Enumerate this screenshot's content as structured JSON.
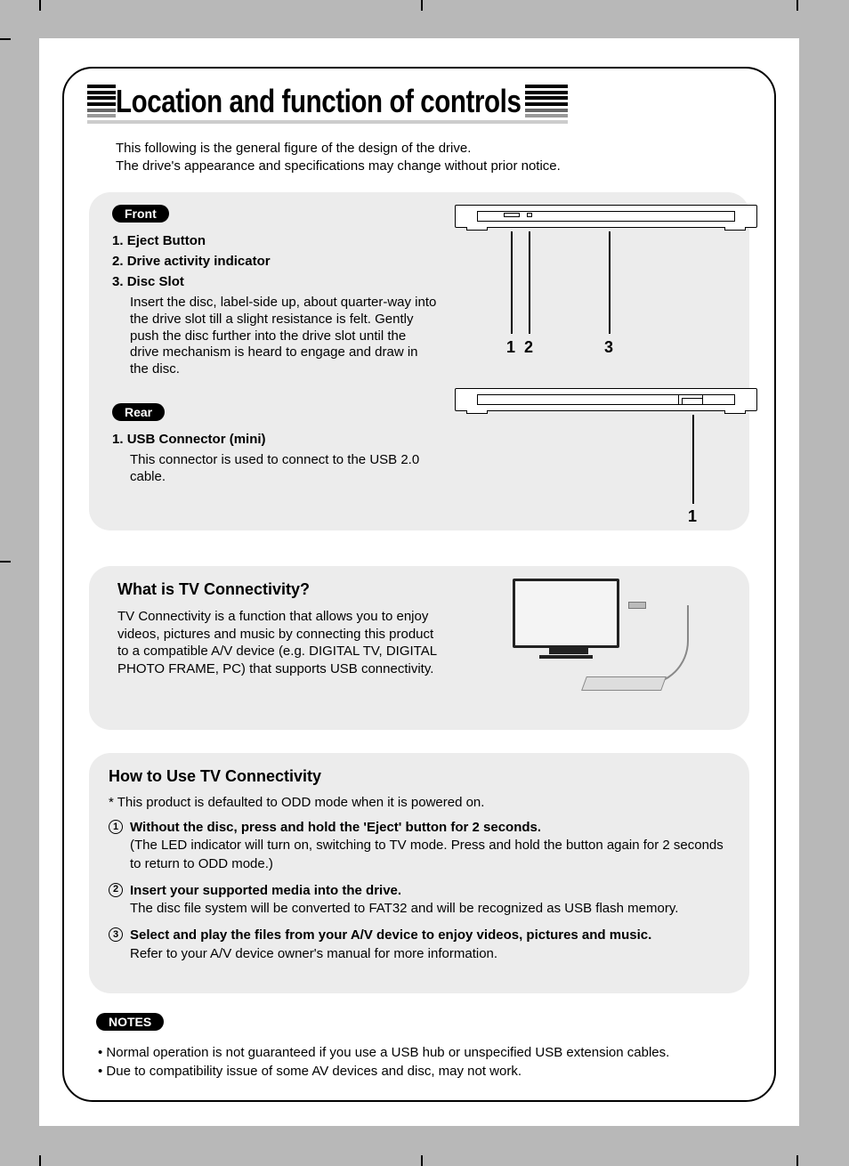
{
  "title": "Location and function of controls",
  "intro_line1": "This following is the general figure of the design of the drive.",
  "intro_line2": "The drive's appearance and specifications may change without prior notice.",
  "front": {
    "label": "Front",
    "items": [
      {
        "num": "1.",
        "name": "Eject Button"
      },
      {
        "num": "2.",
        "name": "Drive activity indicator"
      },
      {
        "num": "3.",
        "name": "Disc Slot"
      }
    ],
    "disc_slot_desc": "Insert the disc, label-side up, about quarter-way into the drive slot till a slight resistance is felt. Gently push the disc further into the drive slot until the drive mechanism is heard to engage and draw in the disc.",
    "callouts": [
      "1",
      "2",
      "3"
    ]
  },
  "rear": {
    "label": "Rear",
    "items": [
      {
        "num": "1.",
        "name": "USB Connector (mini)"
      }
    ],
    "usb_desc": "This connector is used to connect to the USB 2.0 cable.",
    "callouts": [
      "1"
    ]
  },
  "tv": {
    "heading": "What is TV Connectivity?",
    "body": "TV Connectivity is a function that allows you to enjoy videos, pictures and music by connecting this product to a compatible A/V device (e.g. DIGITAL TV, DIGITAL PHOTO FRAME, PC) that supports USB connectivity."
  },
  "howto": {
    "heading": "How to Use TV Connectivity",
    "default_note": "* This product is defaulted to ODD mode when it is powered on.",
    "steps": [
      {
        "n": "1",
        "bold": "Without the disc, press and hold the 'Eject' button for 2 seconds.",
        "rest": "(The LED indicator will turn on, switching to TV mode. Press and hold the button again for 2 seconds to return to ODD mode.)"
      },
      {
        "n": "2",
        "bold": "Insert your supported media into the drive.",
        "rest": "The disc file system will be converted to FAT32 and will be recognized as USB flash memory."
      },
      {
        "n": "3",
        "bold": "Select and play the files from your A/V device to enjoy videos, pictures and music.",
        "rest": "Refer to your A/V device owner's manual for more information."
      }
    ]
  },
  "notes": {
    "label": "NOTES",
    "lines": [
      "• Normal operation is not guaranteed if you use a USB hub or unspecified USB extension cables.",
      "• Due to compatibility issue of some AV devices and disc, may not work."
    ]
  }
}
